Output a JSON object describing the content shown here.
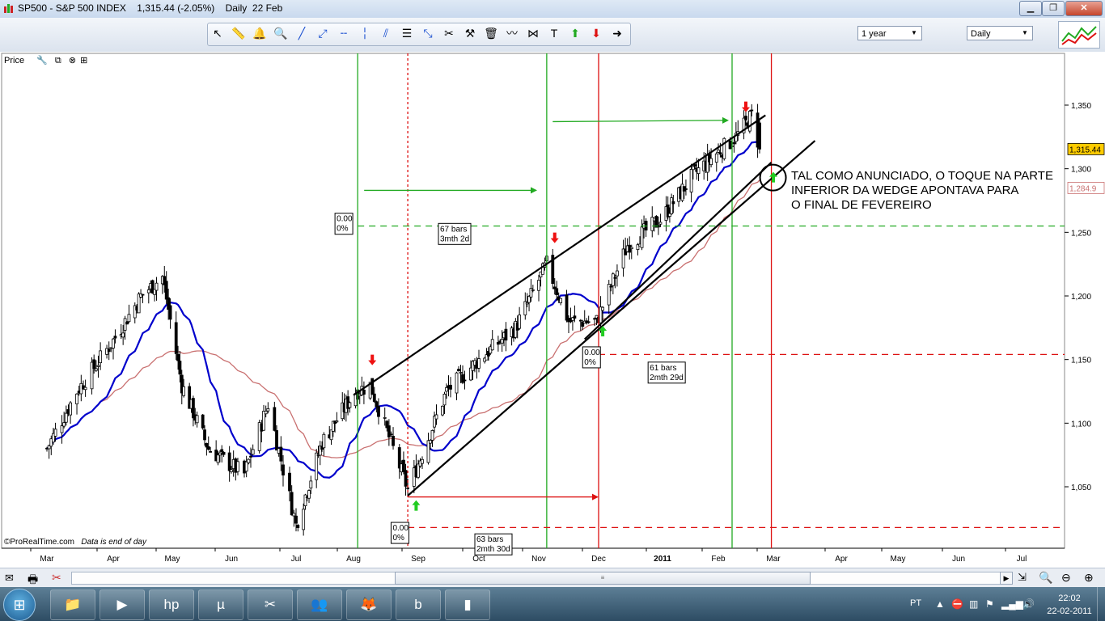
{
  "window": {
    "title": "SP500 - S&P 500 INDEX    1,315.44 (-2.05%)    Daily  22 Feb",
    "minimize_label": "▁",
    "maximize_label": "❐",
    "close_label": "✕"
  },
  "toolbar": {
    "tools": [
      {
        "icon": "cursor-icon",
        "glyph": "↖"
      },
      {
        "icon": "ruler-icon",
        "glyph": "📏"
      },
      {
        "icon": "alarm-icon",
        "glyph": "🔔"
      },
      {
        "icon": "zoom-icon",
        "glyph": "🔍"
      },
      {
        "icon": "line-icon",
        "glyph": "╱"
      },
      {
        "icon": "ray-icon",
        "glyph": "⤢"
      },
      {
        "icon": "horizontal-line-icon",
        "glyph": "╌"
      },
      {
        "icon": "vertical-line-icon",
        "glyph": "╎"
      },
      {
        "icon": "channel-icon",
        "glyph": "⫽"
      },
      {
        "icon": "fibonacci-icon",
        "glyph": "☰"
      },
      {
        "icon": "arrows-icon",
        "glyph": "⤡"
      },
      {
        "icon": "pitchfork-icon",
        "glyph": "✂"
      },
      {
        "icon": "hammer-icon",
        "glyph": "⚒"
      },
      {
        "icon": "trash-icon",
        "glyph": "🗑"
      },
      {
        "icon": "wave-icon",
        "glyph": "〰"
      },
      {
        "icon": "pattern-icon",
        "glyph": "⋈"
      },
      {
        "icon": "text-icon",
        "glyph": "T"
      },
      {
        "icon": "up-arrow-icon",
        "glyph": "⬆"
      },
      {
        "icon": "down-arrow-icon",
        "glyph": "⬇"
      },
      {
        "icon": "right-arrow-icon",
        "glyph": "➜"
      }
    ],
    "period_select": "1 year",
    "interval_select": "Daily"
  },
  "panel": {
    "label": "Price"
  },
  "chart_data": {
    "type": "candlestick",
    "symbol": "SP500",
    "x_labels": [
      "Mar",
      "Apr",
      "May",
      "Jun",
      "Jul",
      "Aug",
      "Sep",
      "Oct",
      "Nov",
      "Dec",
      "2011",
      "Feb",
      "Mar",
      "Apr",
      "May",
      "Jun",
      "Jul"
    ],
    "y_ticks": [
      "1,350",
      "1,300",
      "1,250",
      "1,200",
      "1,150",
      "1,100",
      "1,050"
    ],
    "y_tick_values": [
      1350,
      1300,
      1250,
      1200,
      1150,
      1100,
      1050
    ],
    "ylim": [
      1008,
      1385
    ],
    "last_price_label": "1,315.44",
    "ma_label": "1,284.9",
    "approx_close_path": [
      [
        "2010-03-01",
        1080
      ],
      [
        "2010-03-15",
        1125
      ],
      [
        "2010-04-01",
        1165
      ],
      [
        "2010-04-15",
        1200
      ],
      [
        "2010-04-26",
        1215
      ],
      [
        "2010-05-06",
        1130
      ],
      [
        "2010-05-20",
        1080
      ],
      [
        "2010-06-07",
        1060
      ],
      [
        "2010-06-18",
        1115
      ],
      [
        "2010-07-01",
        1020
      ],
      [
        "2010-07-15",
        1085
      ],
      [
        "2010-08-02",
        1125
      ],
      [
        "2010-08-09",
        1130
      ],
      [
        "2010-08-27",
        1048
      ],
      [
        "2010-09-15",
        1125
      ],
      [
        "2010-10-01",
        1150
      ],
      [
        "2010-10-20",
        1175
      ],
      [
        "2010-11-05",
        1225
      ],
      [
        "2010-11-16",
        1180
      ],
      [
        "2010-11-30",
        1180
      ],
      [
        "2010-12-15",
        1240
      ],
      [
        "2010-12-31",
        1260
      ],
      [
        "2011-01-18",
        1295
      ],
      [
        "2011-02-10",
        1325
      ],
      [
        "2011-02-18",
        1342
      ],
      [
        "2011-02-22",
        1315.44
      ]
    ],
    "series": [
      {
        "name": "",
        "color": "#0000cc",
        "kind": "moving-average-fast"
      },
      {
        "name": "",
        "color": "#c97070",
        "kind": "moving-average-slow"
      }
    ],
    "annotations": {
      "boxes": [
        {
          "lines": [
            "0.00",
            "0%"
          ]
        },
        {
          "lines": [
            "67 bars",
            "3mth 2d"
          ]
        },
        {
          "lines": [
            "0.00",
            "0%"
          ]
        },
        {
          "lines": [
            "61 bars",
            "2mth 29d"
          ]
        },
        {
          "lines": [
            "0.00",
            "0%"
          ]
        },
        {
          "lines": [
            "63 bars",
            "2mth 30d"
          ]
        }
      ],
      "note": [
        "TAL COMO ANUNCIADO, O TOQUE NA PARTE",
        "INFERIOR DA WEDGE APONTAVA PARA",
        "O FINAL DE FEVEREIRO"
      ]
    },
    "colors": {
      "green": "#22aa22",
      "red": "#dd1111",
      "wedge": "#000000"
    }
  },
  "credit": {
    "source": "©ProRealTime.com",
    "note": "Data is end of day"
  },
  "taskbar": {
    "language": "PT",
    "time": "22:02",
    "date": "22-02-2011",
    "apps": [
      {
        "icon": "explorer-icon",
        "glyph": "📁"
      },
      {
        "icon": "media-player-icon",
        "glyph": "▶"
      },
      {
        "icon": "hp-icon",
        "glyph": "hp"
      },
      {
        "icon": "utorrent-icon",
        "glyph": "µ"
      },
      {
        "icon": "paint-icon",
        "glyph": "✂"
      },
      {
        "icon": "messenger-icon",
        "glyph": "👥"
      },
      {
        "icon": "firefox-icon",
        "glyph": "🦊"
      },
      {
        "icon": "b-icon",
        "glyph": "b"
      },
      {
        "icon": "prorealtime-icon",
        "glyph": "▮"
      }
    ]
  }
}
